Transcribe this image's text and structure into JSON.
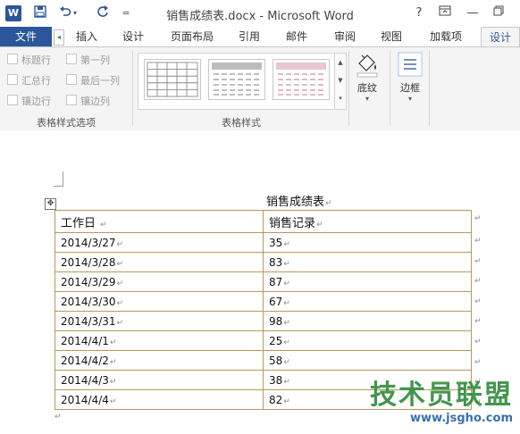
{
  "titlebar": {
    "title": "销售成绩表.docx - Microsoft Word",
    "word_icon": "W",
    "save_icon": "save-icon",
    "undo_icon": "undo-icon",
    "redo_icon": "redo-icon",
    "help_label": "?",
    "ribbon_display_icon": "ribbon-display-icon",
    "minimize_label": "—",
    "qat_more_label": "="
  },
  "tabs": {
    "file": "文件",
    "items": [
      "插入",
      "设计",
      "页面布局",
      "引用",
      "邮件",
      "审阅",
      "视图",
      "加载项",
      "设计"
    ]
  },
  "ribbon": {
    "style_options": {
      "items": [
        "标题行",
        "第一列",
        "汇总行",
        "最后一列",
        "镶边行",
        "镶边列"
      ],
      "group_label": "表格样式选项"
    },
    "table_styles": {
      "group_label": "表格样式"
    },
    "shading_label": "底纹",
    "borders_label": "边框"
  },
  "document": {
    "heading": "销售成绩表",
    "columns": [
      "工作日",
      "销售记录"
    ],
    "rows": [
      [
        "2014/3/27",
        "35"
      ],
      [
        "2014/3/28",
        "83"
      ],
      [
        "2014/3/29",
        "87"
      ],
      [
        "2014/3/30",
        "67"
      ],
      [
        "2014/3/31",
        "98"
      ],
      [
        "2014/4/1",
        "25"
      ],
      [
        "2014/4/2",
        "58"
      ],
      [
        "2014/4/3",
        "38"
      ],
      [
        "2014/4/4",
        "82"
      ]
    ],
    "paragraph_mark": "↵"
  },
  "watermark": {
    "title": "技术员联盟",
    "url": "www.jsgho.com"
  },
  "colors": {
    "accent": "#2b579a",
    "table_border": "#b8985a",
    "watermark_green": "#2e8b3a"
  }
}
